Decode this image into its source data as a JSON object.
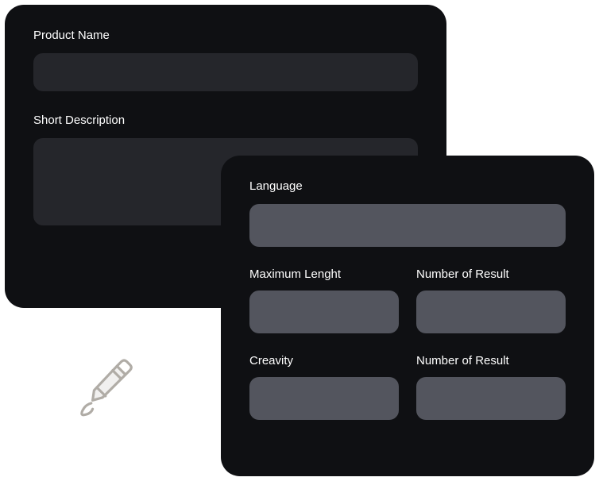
{
  "back_card": {
    "product_name": {
      "label": "Product Name",
      "value": ""
    },
    "short_description": {
      "label": "Short Description",
      "value": ""
    }
  },
  "front_card": {
    "language": {
      "label": "Language",
      "value": ""
    },
    "maximum_length": {
      "label": "Maximum Lenght",
      "value": ""
    },
    "number_of_result_1": {
      "label": "Number of Result",
      "value": ""
    },
    "creativity": {
      "label": "Creavity",
      "value": ""
    },
    "number_of_result_2": {
      "label": "Number of Result",
      "value": ""
    }
  }
}
